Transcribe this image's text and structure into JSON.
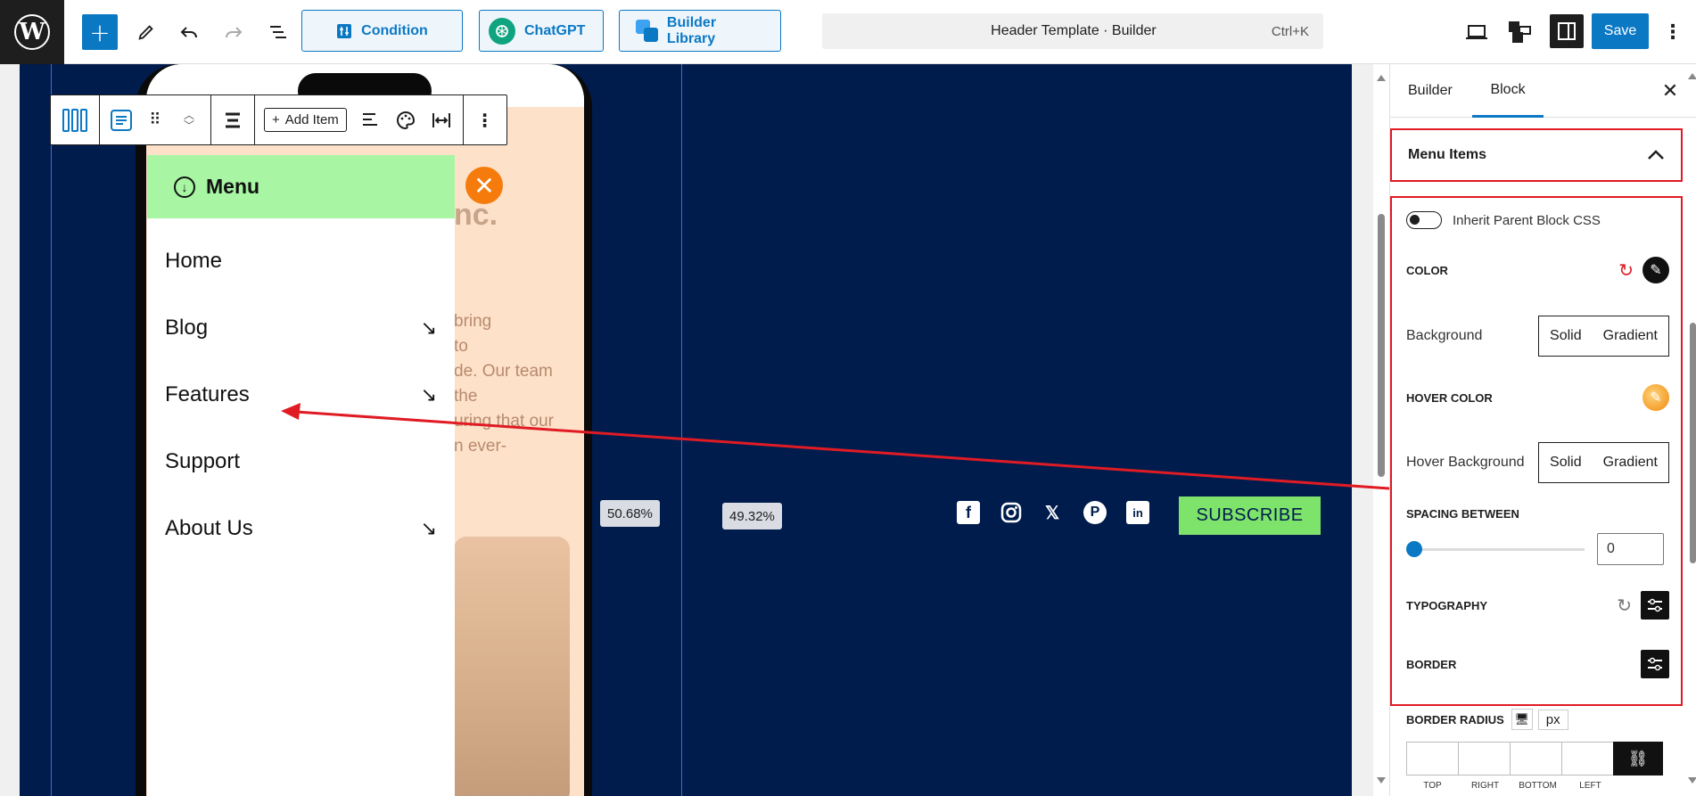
{
  "topbar": {
    "condition_label": "Condition",
    "chatgpt_label": "ChatGPT",
    "library_label": "Builder Library",
    "command_title": "Header Template · Builder",
    "command_shortcut": "Ctrl+K",
    "save_label": "Save"
  },
  "canvas": {
    "menu_title": "Menu",
    "menu_items": [
      {
        "label": "Home",
        "has_submenu": false
      },
      {
        "label": "Blog",
        "has_submenu": true
      },
      {
        "label": "Features",
        "has_submenu": true
      },
      {
        "label": "Support",
        "has_submenu": false
      },
      {
        "label": "About Us",
        "has_submenu": true
      }
    ],
    "bg_logo_fragment": "nc.",
    "bg_text_lines": [
      "bring",
      "to",
      "de. Our team",
      "the",
      "uring that our",
      "n ever-"
    ],
    "add_item_label": "Add Item",
    "left_width_pct": "50.68%",
    "right_width_pct": "49.32%",
    "subscribe_label": "SUBSCRIBE",
    "social_icons": [
      "facebook-icon",
      "instagram-icon",
      "x-icon",
      "pinterest-icon",
      "linkedin-icon"
    ]
  },
  "sidebar": {
    "tab_builder": "Builder",
    "tab_block": "Block",
    "section_title": "Menu Items",
    "inherit_label": "Inherit Parent Block CSS",
    "color_label": "COLOR",
    "background_label": "Background",
    "solid_label": "Solid",
    "gradient_label": "Gradient",
    "hover_color_label": "HOVER COLOR",
    "hover_background_label": "Hover Background",
    "spacing_label": "SPACING BETWEEN",
    "spacing_value": "0",
    "typography_label": "TYPOGRAPHY",
    "border_label": "BORDER",
    "border_radius_label": "BORDER RADIUS",
    "radius_unit": "px",
    "radius_sides": [
      "TOP",
      "RIGHT",
      "BOTTOM",
      "LEFT"
    ]
  },
  "colors": {
    "accent": "#0b78c4",
    "canvas_navy": "#001c4d",
    "menu_header": "#a8f5a4",
    "close_orange": "#f57c0c",
    "subscribe_green": "#7ee36b",
    "highlight_red": "#e01b24"
  }
}
